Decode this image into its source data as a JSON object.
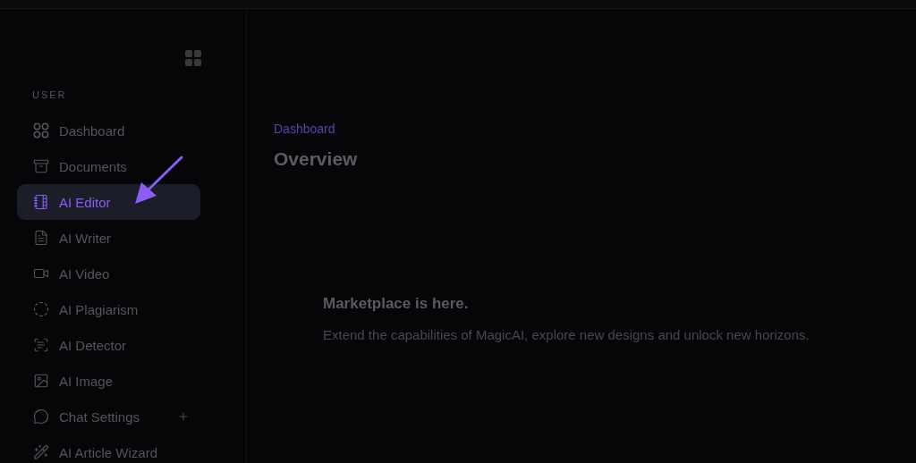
{
  "sidebar": {
    "section_label": "USER",
    "items": [
      {
        "label": "Dashboard",
        "selected": false,
        "has_submenu": false
      },
      {
        "label": "Documents",
        "selected": false,
        "has_submenu": false
      },
      {
        "label": "AI Editor",
        "selected": true,
        "has_submenu": false
      },
      {
        "label": "AI Writer",
        "selected": false,
        "has_submenu": false
      },
      {
        "label": "AI Video",
        "selected": false,
        "has_submenu": false
      },
      {
        "label": "AI Plagiarism",
        "selected": false,
        "has_submenu": false
      },
      {
        "label": "AI Detector",
        "selected": false,
        "has_submenu": false
      },
      {
        "label": "AI Image",
        "selected": false,
        "has_submenu": false
      },
      {
        "label": "Chat Settings",
        "selected": false,
        "has_submenu": true
      },
      {
        "label": "AI Article Wizard",
        "selected": false,
        "has_submenu": false
      }
    ]
  },
  "main": {
    "breadcrumb": "Dashboard",
    "title": "Overview",
    "banner": {
      "heading": "Marketplace is here.",
      "text": "Extend the capabilities of MagicAI, explore new designs and unlock new horizons."
    }
  }
}
